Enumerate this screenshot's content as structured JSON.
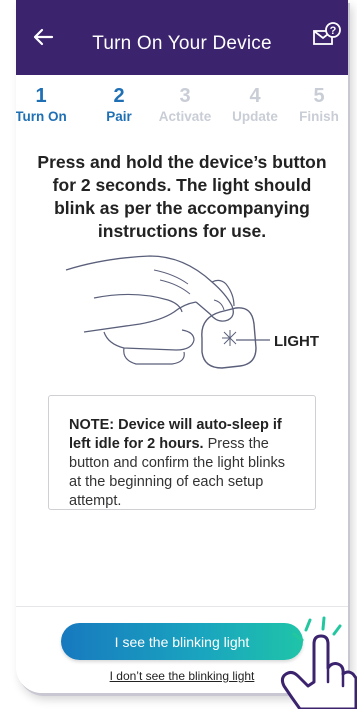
{
  "header": {
    "title": "Turn On Your Device",
    "back_icon": "arrow-left-icon",
    "help_icon": "envelope-question-icon"
  },
  "steps": [
    {
      "number": "1",
      "label": "Turn On",
      "state": "done"
    },
    {
      "number": "2",
      "label": "Pair",
      "state": "current"
    },
    {
      "number": "3",
      "label": "Activate",
      "state": "todo"
    },
    {
      "number": "4",
      "label": "Update",
      "state": "todo"
    },
    {
      "number": "5",
      "label": "Finish",
      "state": "todo"
    }
  ],
  "instruction": "Press and hold the device’s button for 2 seconds. The light should blink as per the accompanying instructions for use.",
  "illustration": {
    "light_label": "LIGHT"
  },
  "note": {
    "bold": "NOTE: Device will auto-sleep if left idle for 2 hours.",
    "text": " Press the button and confirm the light blinks at the beginning of each setup attempt."
  },
  "actions": {
    "primary_label": "I see the blinking light",
    "secondary_label": "I don’t see the blinking light"
  },
  "colors": {
    "header_bg": "#3b236e",
    "step_active": "#1f6fb5",
    "step_inactive": "#c9cdd6",
    "button_gradient_start": "#1779bf",
    "button_gradient_end": "#1fc4a8"
  }
}
